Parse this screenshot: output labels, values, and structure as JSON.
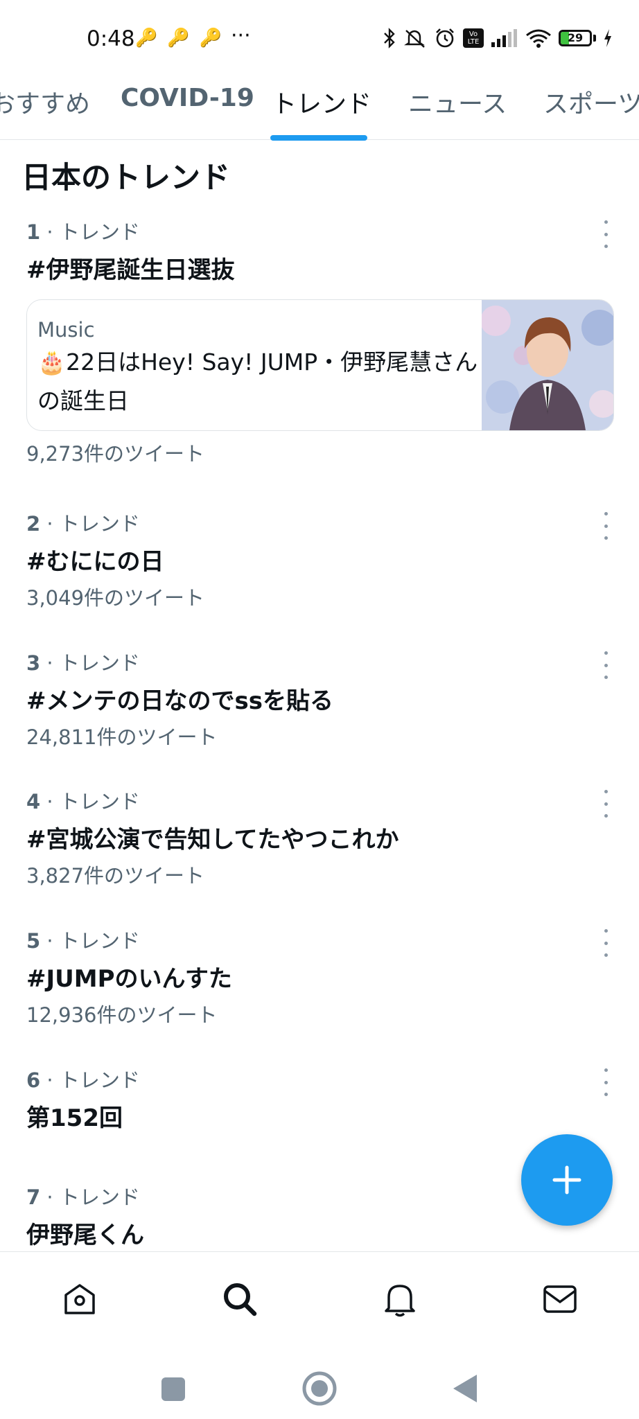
{
  "status_bar": {
    "time": "0:48",
    "more": "···",
    "battery": "29",
    "battery_level": 0.29,
    "volte": "Vo LTE"
  },
  "tabs": [
    {
      "label": "おすすめ"
    },
    {
      "label": "COVID-19"
    },
    {
      "label": "トレンド"
    },
    {
      "label": "ニュース"
    },
    {
      "label": "スポーツ"
    }
  ],
  "section_title": "日本のトレンド",
  "trends": [
    {
      "rank": "1",
      "meta": "· トレンド",
      "name": "#伊野尾誕生日選抜",
      "count": "9,273件のツイート"
    },
    {
      "rank": "2",
      "meta": "· トレンド",
      "name": "#むににの日",
      "count": "3,049件のツイート"
    },
    {
      "rank": "3",
      "meta": "· トレンド",
      "name": "#メンテの日なのでssを貼る",
      "count": "24,811件のツイート"
    },
    {
      "rank": "4",
      "meta": "· トレンド",
      "name": "#宮城公演で告知してたやつこれか",
      "count": "3,827件のツイート"
    },
    {
      "rank": "5",
      "meta": "· トレンド",
      "name": "#JUMPのいんすた",
      "count": "12,936件のツイート"
    },
    {
      "rank": "6",
      "meta": "· トレンド",
      "name": "第152回",
      "count": ""
    },
    {
      "rank": "7",
      "meta": "· トレンド",
      "name": "伊野尾くん",
      "count": ""
    }
  ],
  "news_card": {
    "category": "Music",
    "emoji": "🎂",
    "text": "22日はHey! Say! JUMP・伊野尾慧さんの誕生日"
  },
  "fab": {
    "icon": "plus-icon"
  },
  "bottom_nav": [
    {
      "icon": "home-icon"
    },
    {
      "icon": "search-icon"
    },
    {
      "icon": "bell-icon"
    },
    {
      "icon": "mail-icon"
    }
  ],
  "system_nav": [
    {
      "icon": "recents-icon"
    },
    {
      "icon": "home-circle-icon"
    },
    {
      "icon": "back-icon"
    }
  ],
  "colors": {
    "accent": "#1d9bf0",
    "text_primary": "#0f1419",
    "text_secondary": "#536471"
  }
}
